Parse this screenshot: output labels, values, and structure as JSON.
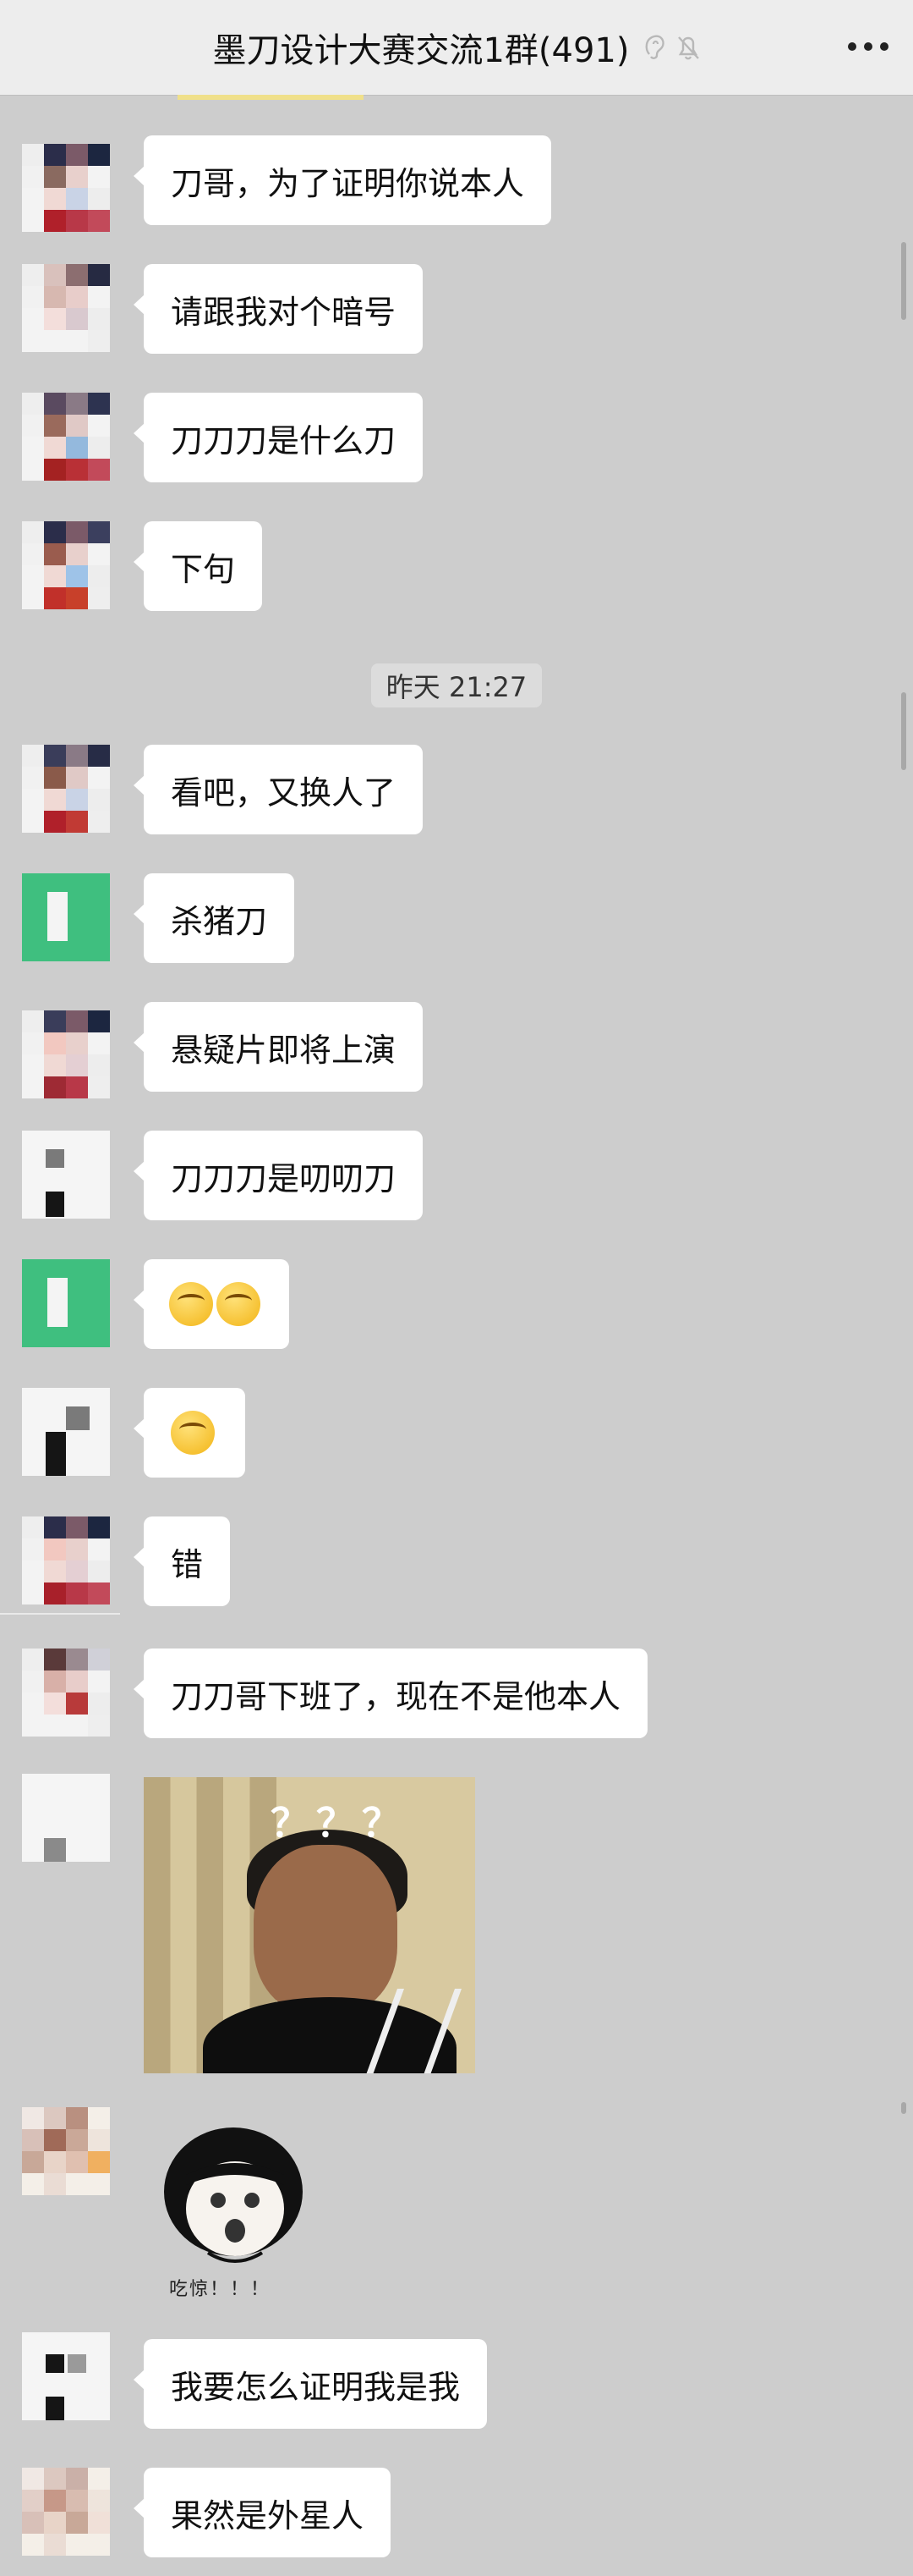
{
  "header": {
    "title": "墨刀设计大赛交流1群(491)",
    "icons": [
      "ear-icon",
      "mute-bell-icon"
    ],
    "more_icon": "more-icon"
  },
  "timestamp": "昨天 21:27",
  "messages": [
    {
      "text": "刀哥，为了证明你说本人"
    },
    {
      "text": "请跟我对个暗号"
    },
    {
      "text": "刀刀刀是什么刀"
    },
    {
      "text": "下句"
    },
    {
      "text": "看吧，又换人了"
    },
    {
      "text": "杀猪刀"
    },
    {
      "text": "悬疑片即将上演"
    },
    {
      "text": "刀刀刀是叨叨刀"
    },
    {
      "emoji": [
        "smirk-emoji",
        "smirk-emoji"
      ]
    },
    {
      "emoji": [
        "smirk-emoji"
      ]
    },
    {
      "text": "错"
    },
    {
      "text": "刀刀哥下班了，现在不是他本人"
    },
    {
      "image": "confused-boy-photo",
      "overlay_text": "？？？"
    },
    {
      "sticker": "shocked-face-sticker",
      "caption": "吃惊！！！"
    },
    {
      "text": "我要怎么证明我是我"
    },
    {
      "text": "果然是外星人"
    }
  ],
  "colors": {
    "background": "#cdcdcd",
    "header": "#ededed",
    "bubble": "#ffffff",
    "green_avatar": "#3fbf7f"
  }
}
